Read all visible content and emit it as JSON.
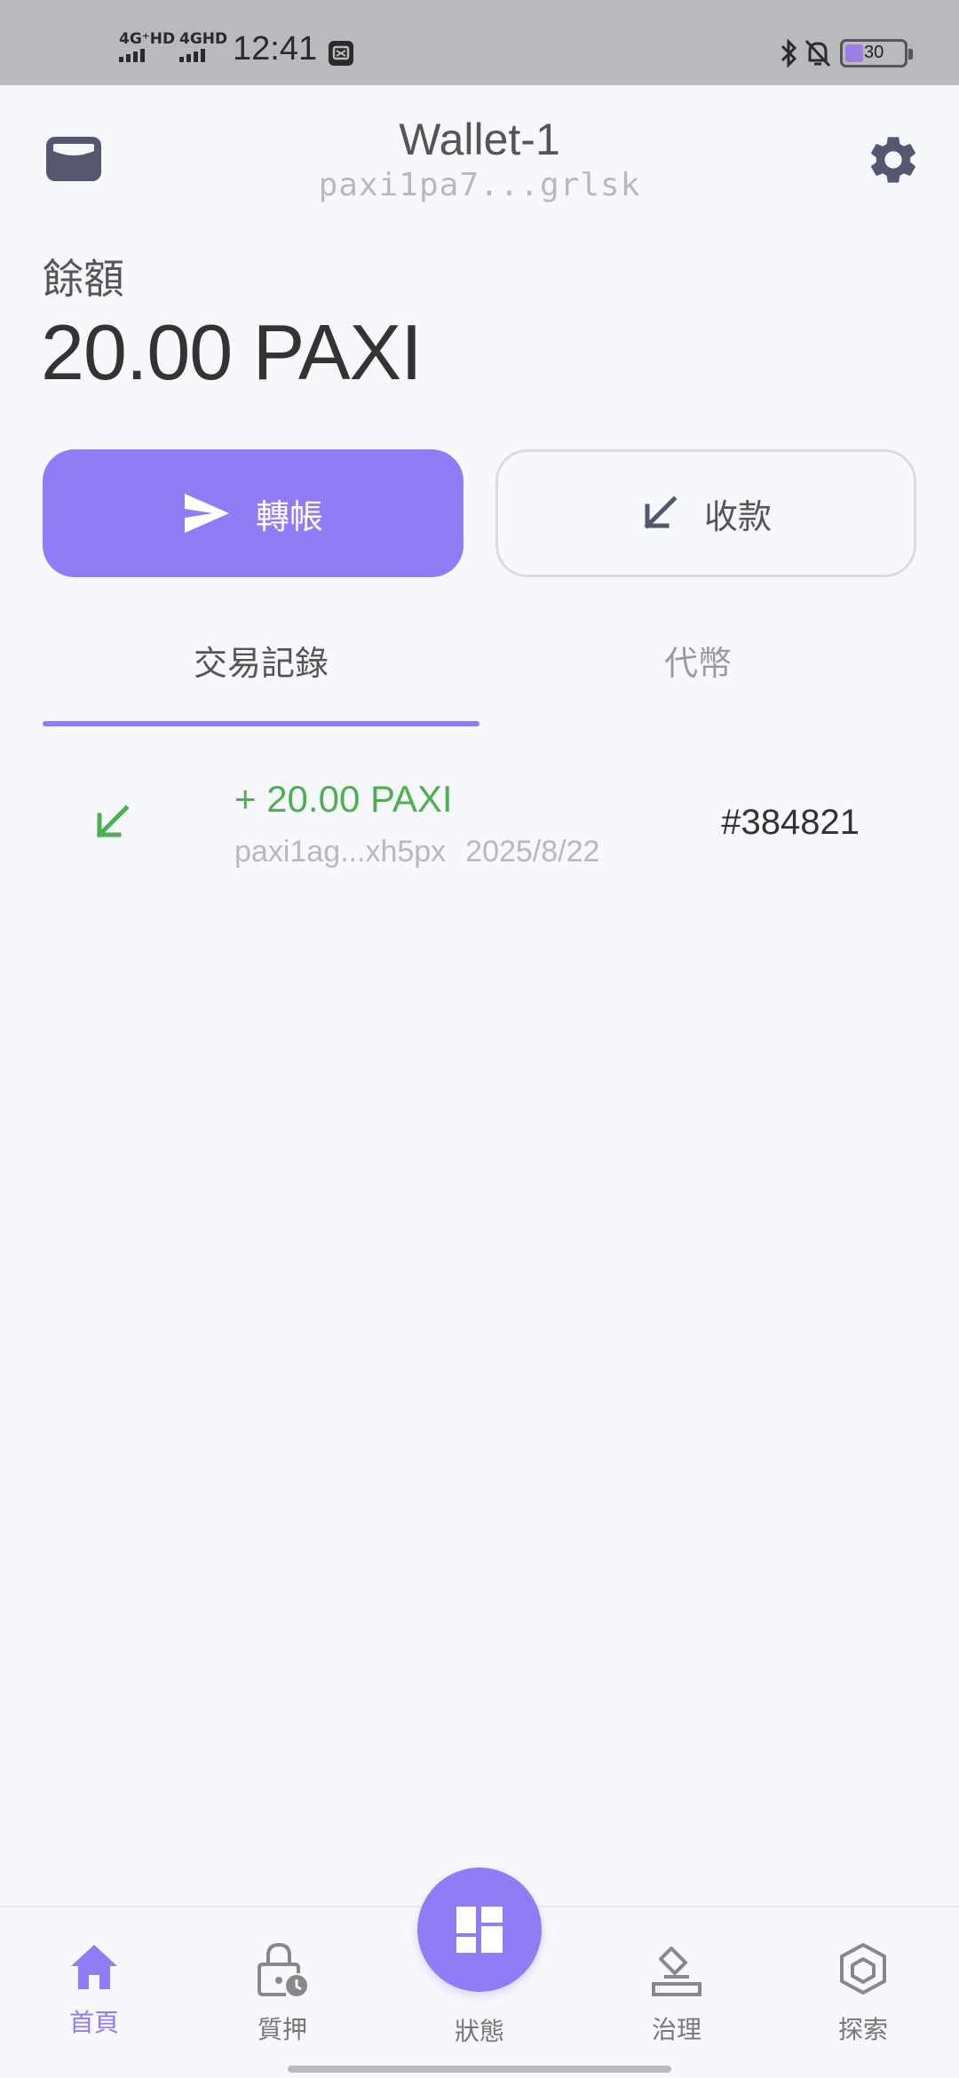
{
  "status_bar": {
    "net1_label": "4G⁺HD",
    "net2_label": "4GHD",
    "time": "12:41",
    "battery": "30"
  },
  "header": {
    "title": "Wallet-1",
    "address": "paxi1pa7...grlsk"
  },
  "balance": {
    "label": "餘額",
    "value": "20.00 PAXI"
  },
  "actions": {
    "send_label": "轉帳",
    "receive_label": "收款"
  },
  "tabs": [
    {
      "label": "交易記錄",
      "active": true
    },
    {
      "label": "代幣",
      "active": false
    }
  ],
  "transactions": [
    {
      "amount": "+ 20.00 PAXI",
      "from": "paxi1ag...xh5px",
      "date": "2025/8/22",
      "block": "#384821"
    }
  ],
  "nav": {
    "items": [
      {
        "label": "首頁",
        "icon": "home-icon",
        "active": true
      },
      {
        "label": "質押",
        "icon": "lock-clock-icon",
        "active": false
      },
      {
        "label": "狀態",
        "icon": "dashboard-icon",
        "active": false
      },
      {
        "label": "治理",
        "icon": "vote-icon",
        "active": false
      },
      {
        "label": "探索",
        "icon": "cube-icon",
        "active": false
      }
    ]
  },
  "colors": {
    "accent": "#8f7cf7",
    "incoming": "#4caf50",
    "icon_dark": "#555770"
  }
}
